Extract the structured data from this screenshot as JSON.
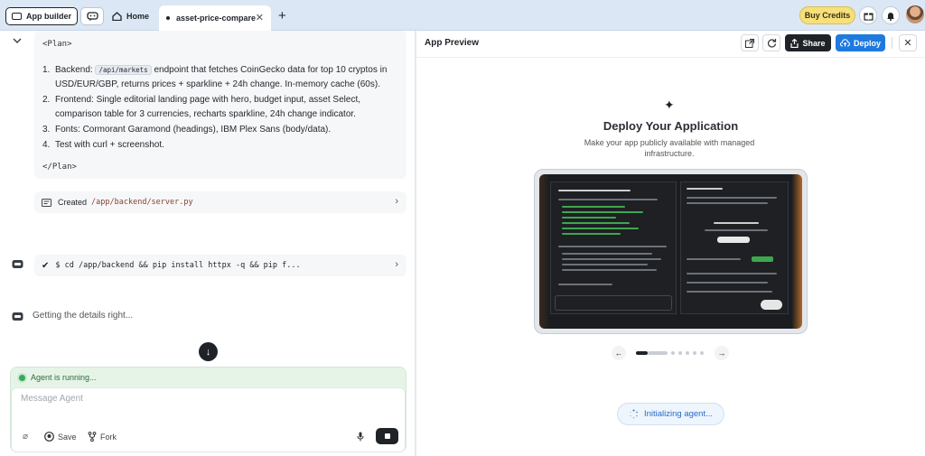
{
  "topbar": {
    "app_builder_label": "App builder",
    "home_tab_label": "Home",
    "active_tab_label": "asset-price-compare",
    "buy_credits_label": "Buy Credits"
  },
  "chat": {
    "plan_open_tag": "<Plan>",
    "plan_close_tag": "</Plan>",
    "plan_items": [
      {
        "num": "1.",
        "prefix": "Backend:",
        "code": "/api/markets",
        "text": "endpoint that fetches CoinGecko data for top 10 cryptos in USD/EUR/GBP, returns prices + sparkline + 24h change. In-memory cache (60s)."
      },
      {
        "num": "2.",
        "text": "Frontend: Single editorial landing page with hero, budget input, asset Select, comparison table for 3 currencies, recharts sparkline, 24h change indicator."
      },
      {
        "num": "3.",
        "text": "Fonts: Cormorant Garamond (headings), IBM Plex Sans (body/data)."
      },
      {
        "num": "4.",
        "text": "Test with curl + screenshot."
      }
    ],
    "created_label": "Created",
    "created_path": "/app/backend/server.py",
    "command_text": "$ cd /app/backend && pip install httpx -q && pip f...",
    "details_text": "Getting the details right...",
    "agent_status": "Agent is running...",
    "message_placeholder": "Message Agent",
    "save_label": "Save",
    "fork_label": "Fork"
  },
  "preview": {
    "title": "App Preview",
    "share_label": "Share",
    "deploy_label": "Deploy",
    "heading": "Deploy Your Application",
    "subtext": "Make your app publicly available with managed infrastructure.",
    "carousel_total": 7,
    "carousel_active": 1,
    "init_label": "Initializing agent..."
  },
  "colors": {
    "topbar_bg": "#dbe7f4",
    "deploy_blue": "#1f7ae0",
    "agent_green": "#39a85a",
    "buy_credits_yellow": "#f7df7a"
  }
}
